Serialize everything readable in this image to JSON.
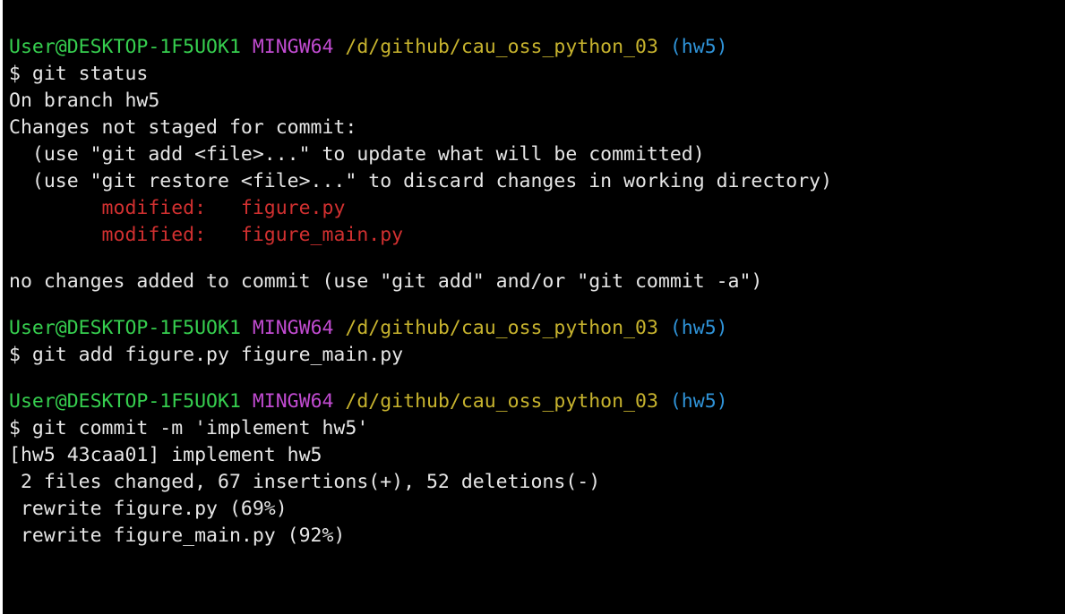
{
  "prompt": {
    "user_host": "User@DESKTOP-1F5UOK1",
    "shell": "MINGW64",
    "path": "/d/github/cau_oss_python_03",
    "branch": "(hw5)"
  },
  "lines": {
    "cmd_status": "$ git status",
    "on_branch": "On branch hw5",
    "not_staged": "Changes not staged for commit:",
    "hint_add": "  (use \"git add <file>...\" to update what will be committed)",
    "hint_restore": "  (use \"git restore <file>...\" to discard changes in working directory)",
    "mod1_label": "        modified:   ",
    "mod1_file": "figure.py",
    "mod2_label": "        modified:   ",
    "mod2_file": "figure_main.py",
    "no_changes": "no changes added to commit (use \"git add\" and/or \"git commit -a\")",
    "cmd_add": "$ git add figure.py figure_main.py",
    "cmd_commit": "$ git commit -m 'implement hw5'",
    "commit_result": "[hw5 43caa01] implement hw5",
    "files_changed": " 2 files changed, 67 insertions(+), 52 deletions(-)",
    "rewrite1": " rewrite figure.py (69%)",
    "rewrite2": " rewrite figure_main.py (92%)"
  },
  "colors": {
    "background": "#000000",
    "text": "#e6e6e6",
    "user_host": "#36cf4f",
    "shell": "#c14bd1",
    "path": "#c7b32e",
    "branch": "#2f93d8",
    "modified": "#d13030"
  }
}
